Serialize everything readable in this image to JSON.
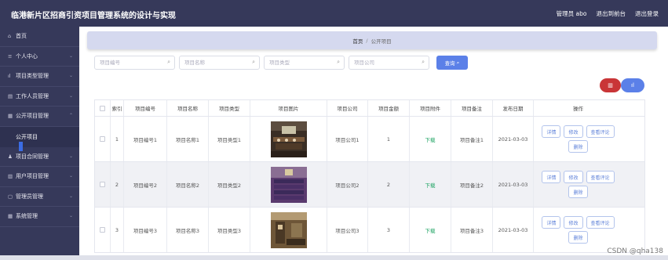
{
  "app": {
    "title": "临港新片区招商引资项目管理系统的设计与实现"
  },
  "header": {
    "admin": "管理员 abo",
    "to_front": "退出到前台",
    "logout": "退出登录"
  },
  "sidebar": {
    "items": [
      {
        "label": "首页",
        "icon": "home-icon",
        "glyph": "⌂"
      },
      {
        "label": "个人中心",
        "icon": "user-icon",
        "glyph": "≡"
      },
      {
        "label": "项目类型管理",
        "icon": "chart-icon",
        "glyph": "ıl"
      },
      {
        "label": "工作人员管理",
        "icon": "folder-icon",
        "glyph": "▤"
      },
      {
        "label": "公开项目管理",
        "icon": "doc-icon",
        "glyph": "▦"
      },
      {
        "label": "公开项目",
        "icon": "",
        "glyph": ""
      },
      {
        "label": "项目合同管理",
        "icon": "person-icon",
        "glyph": "♟"
      },
      {
        "label": "用户项目管理",
        "icon": "list-icon",
        "glyph": "▥"
      },
      {
        "label": "管理员管理",
        "icon": "admin-icon",
        "glyph": "▢"
      },
      {
        "label": "系统管理",
        "icon": "system-icon",
        "glyph": "▦"
      }
    ]
  },
  "breadcrumb": {
    "home": "首页",
    "sep": "/",
    "current": "公开项目"
  },
  "search": {
    "no_placeholder": "项目编号",
    "name_placeholder": "项目名称",
    "type_placeholder": "项目类型",
    "company_placeholder": "项目公司",
    "query_label": "查询"
  },
  "table": {
    "headers": [
      "索引",
      "项目编号",
      "项目名称",
      "项目类型",
      "项目图片",
      "项目公司",
      "项目金额",
      "项目附件",
      "项目备注",
      "发布日期",
      "操作"
    ],
    "rows": [
      {
        "idx": "1",
        "no": "项目编号1",
        "name": "项目名称1",
        "type": "项目类型1",
        "company": "项目公司1",
        "amount": "1",
        "attachment": "下载",
        "note": "项目备注1",
        "date": "2021-03-03"
      },
      {
        "idx": "2",
        "no": "项目编号2",
        "name": "项目名称2",
        "type": "项目类型2",
        "company": "项目公司2",
        "amount": "2",
        "attachment": "下载",
        "note": "项目备注2",
        "date": "2021-03-03"
      },
      {
        "idx": "3",
        "no": "项目编号3",
        "name": "项目名称3",
        "type": "项目类型3",
        "company": "项目公司3",
        "amount": "3",
        "attachment": "下载",
        "note": "项目备注3",
        "date": "2021-03-03"
      }
    ],
    "ops": {
      "detail": "详情",
      "edit": "修改",
      "comments": "查看评论",
      "delete": "删除"
    }
  },
  "watermark": "CSDN @qha138",
  "colors": {
    "sidebar": "#36395a",
    "primary": "#5b80e8",
    "danger": "#c93537",
    "download": "#1aa260"
  }
}
